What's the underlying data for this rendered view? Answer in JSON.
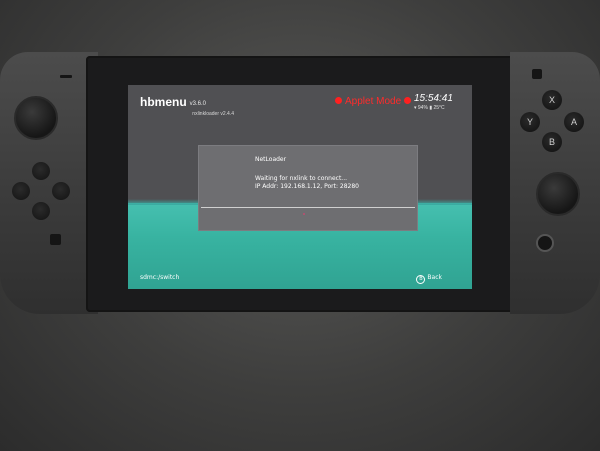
{
  "menu": {
    "title": "hbmenu",
    "version": "v3.6.0",
    "nxlink_version": "nxlinkloader v2.4.4"
  },
  "applet_mode": "Applet Mode",
  "clock": {
    "time": "15:54:41",
    "battery": "94%",
    "temperature": "25°C"
  },
  "netloader": {
    "title": "NetLoader",
    "message": "Waiting for nxlink to connect...",
    "ip_info": "IP Addr: 192.168.1.12, Port: 28280"
  },
  "footer": {
    "path": "sdmc:/switch",
    "back_glyph": "B",
    "back_label": "Back"
  },
  "controls": {
    "x": "X",
    "y": "Y",
    "a": "A",
    "b": "B",
    "plus": "+",
    "minus": "−"
  },
  "colors": {
    "applet_red": "#ff2b2b",
    "teal": "#38b3a1",
    "screen_bg": "#505053"
  }
}
